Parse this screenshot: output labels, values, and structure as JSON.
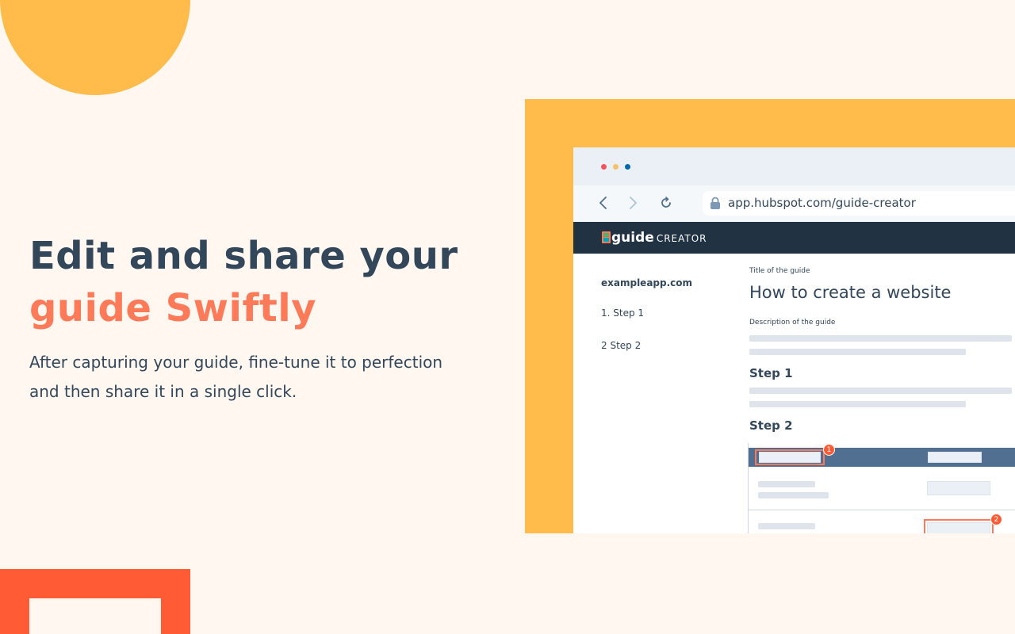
{
  "hero": {
    "title_line1": "Edit and share your",
    "title_line2": "guide Swiftly",
    "subtitle_line1": "After capturing your guide, fine-tune it to perfection",
    "subtitle_line2": "and then share it in a single click."
  },
  "browser": {
    "url": "app.hubspot.com/guide-creator",
    "window_dots": [
      "red",
      "yellow",
      "blue"
    ]
  },
  "app": {
    "name_bold": "guide",
    "name_light": "CREATOR"
  },
  "sidebar": {
    "domain": "exampleapp.com",
    "steps": [
      {
        "label": "1.  Step 1"
      },
      {
        "label": "2  Step 2"
      }
    ]
  },
  "editor": {
    "title_label": "Title of the guide",
    "title_value": "How to create a website",
    "description_label": "Description of the guide",
    "steps": [
      {
        "heading": "Step 1"
      },
      {
        "heading": "Step 2"
      }
    ]
  },
  "screenshot_preview": {
    "badges": [
      "1",
      "2"
    ]
  },
  "colors": {
    "background": "#fff7f0",
    "accent_yellow": "#ffbc4b",
    "accent_orange": "#ff5c35",
    "headline_dark": "#33475b",
    "headline_highlight": "#ff7a59",
    "app_bar": "#213343"
  }
}
